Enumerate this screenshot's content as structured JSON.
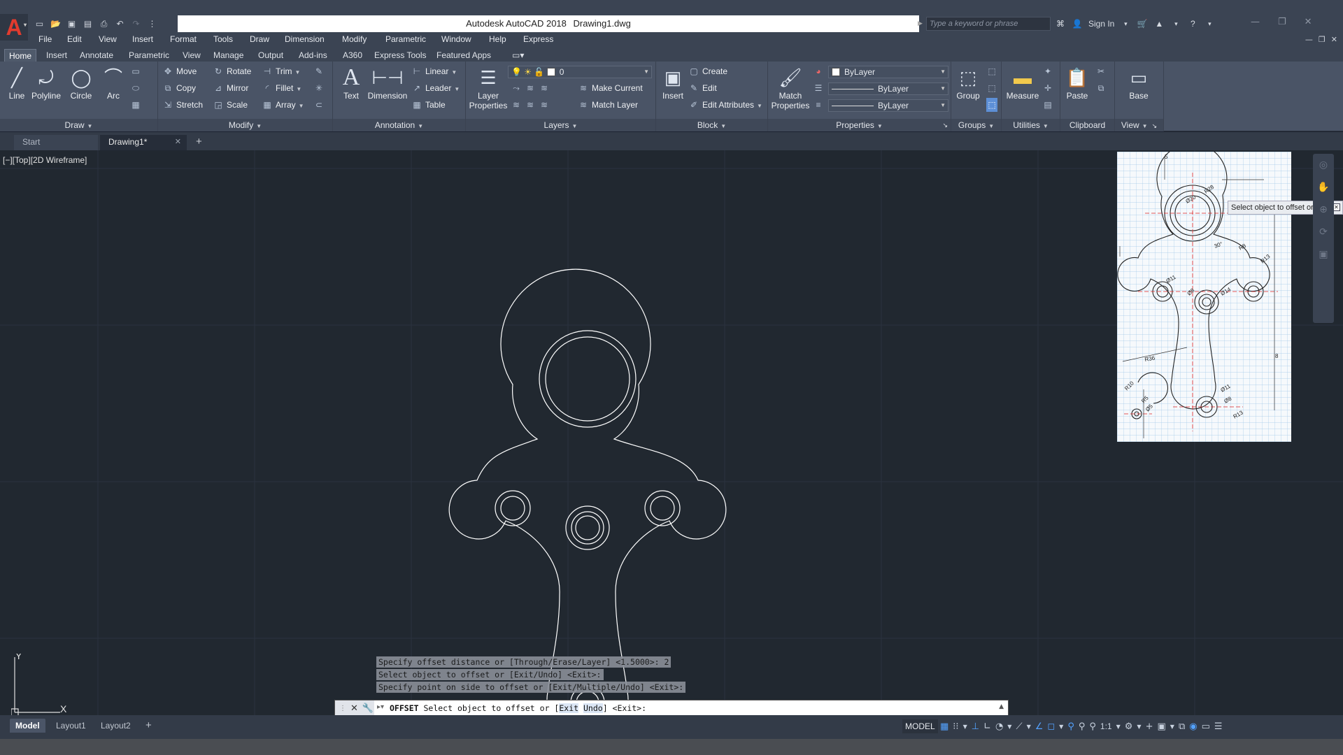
{
  "titlebar": {
    "app_name": "Autodesk AutoCAD 2018",
    "document": "Drawing1.dwg",
    "search_placeholder": "Type a keyword or phrase",
    "sign_in": "Sign In"
  },
  "menu": [
    "File",
    "Edit",
    "View",
    "Insert",
    "Format",
    "Tools",
    "Draw",
    "Dimension",
    "Modify",
    "Parametric",
    "Window",
    "Help",
    "Express"
  ],
  "ribbon_tabs": [
    "Home",
    "Insert",
    "Annotate",
    "Parametric",
    "View",
    "Manage",
    "Output",
    "Add-ins",
    "A360",
    "Express Tools",
    "Featured Apps"
  ],
  "panels": {
    "draw": {
      "title": "Draw",
      "line": "Line",
      "polyline": "Polyline",
      "circle": "Circle",
      "arc": "Arc"
    },
    "modify": {
      "title": "Modify",
      "move": "Move",
      "rotate": "Rotate",
      "trim": "Trim",
      "copy": "Copy",
      "mirror": "Mirror",
      "fillet": "Fillet",
      "stretch": "Stretch",
      "scale": "Scale",
      "array": "Array"
    },
    "annotation": {
      "title": "Annotation",
      "text": "Text",
      "dimension": "Dimension",
      "linear": "Linear",
      "leader": "Leader",
      "table": "Table"
    },
    "layers": {
      "title": "Layers",
      "layer_properties_1": "Layer",
      "layer_properties_2": "Properties",
      "current_layer": "0",
      "make_current": "Make Current",
      "match_layer": "Match Layer"
    },
    "block": {
      "title": "Block",
      "insert": "Insert",
      "create": "Create",
      "edit": "Edit",
      "edit_attributes": "Edit Attributes"
    },
    "properties": {
      "title": "Properties",
      "match_1": "Match",
      "match_2": "Properties",
      "color": "ByLayer",
      "linetype": "ByLayer",
      "lineweight": "ByLayer"
    },
    "groups": {
      "title": "Groups",
      "group": "Group"
    },
    "utilities": {
      "title": "Utilities",
      "measure": "Measure"
    },
    "clipboard": {
      "title": "Clipboard",
      "paste": "Paste"
    },
    "view": {
      "title": "View",
      "base": "Base"
    }
  },
  "file_tabs": {
    "start": "Start",
    "drawing": "Drawing1*"
  },
  "viewport_label": "[−][Top][2D Wireframe]",
  "tooltip": "Select object to offset or",
  "ucs": {
    "x": "X",
    "y": "Y"
  },
  "command_history": [
    "Specify offset distance or [Through/Erase/Layer] <1.5000>: 2",
    "Select object to offset or [Exit/Undo] <Exit>:",
    "Specify point on side to offset or [Exit/Multiple/Undo] <Exit>:"
  ],
  "command_line": {
    "command": "OFFSET",
    "prompt": "Select object to offset or [",
    "option_1": "Exit",
    "option_2": "Undo",
    "suffix": "] <Exit>:"
  },
  "layout_tabs": [
    "Model",
    "Layout1",
    "Layout2"
  ],
  "status": {
    "model": "MODEL",
    "scale": "1:1"
  },
  "ref_labels": [
    "R28",
    "Ø20",
    "R8",
    "R13",
    "Ø11",
    "Ø8",
    "Ø14",
    "R36",
    "Ø11",
    "R10",
    "R5",
    "Ø5",
    "Ø8",
    "R13",
    "30°",
    "8",
    "5"
  ]
}
